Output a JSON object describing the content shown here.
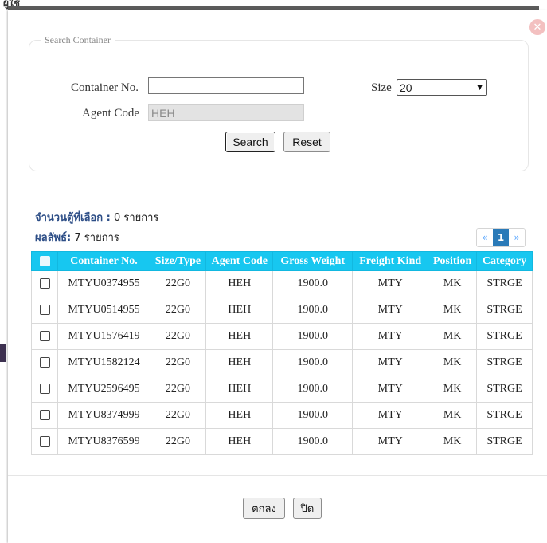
{
  "background": {
    "top_text": "ผู้ใช้"
  },
  "modal": {
    "close_icon": "close-circle-icon",
    "search_panel": {
      "legend": "Search Container",
      "container_no_label": "Container No.",
      "container_no_value": "",
      "size_label": "Size",
      "size_value": "20",
      "agent_code_label": "Agent Code",
      "agent_code_value": "HEH",
      "search_button": "Search",
      "reset_button": "Reset"
    },
    "selected_count_label": "จำนวนตู้ที่เลือก :",
    "selected_count_value": "0 รายการ",
    "results_label": "ผลลัพธ์:",
    "results_value": "7 รายการ",
    "pagination": {
      "prev": "«",
      "current": "1",
      "next": "»"
    },
    "table": {
      "headers": [
        "Container No.",
        "Size/Type",
        "Agent Code",
        "Gross Weight",
        "Freight Kind",
        "Position",
        "Category"
      ],
      "rows": [
        [
          "MTYU0374955",
          "22G0",
          "HEH",
          "1900.0",
          "MTY",
          "MK",
          "STRGE"
        ],
        [
          "MTYU0514955",
          "22G0",
          "HEH",
          "1900.0",
          "MTY",
          "MK",
          "STRGE"
        ],
        [
          "MTYU1576419",
          "22G0",
          "HEH",
          "1900.0",
          "MTY",
          "MK",
          "STRGE"
        ],
        [
          "MTYU1582124",
          "22G0",
          "HEH",
          "1900.0",
          "MTY",
          "MK",
          "STRGE"
        ],
        [
          "MTYU2596495",
          "22G0",
          "HEH",
          "1900.0",
          "MTY",
          "MK",
          "STRGE"
        ],
        [
          "MTYU8374999",
          "22G0",
          "HEH",
          "1900.0",
          "MTY",
          "MK",
          "STRGE"
        ],
        [
          "MTYU8376599",
          "22G0",
          "HEH",
          "1900.0",
          "MTY",
          "MK",
          "STRGE"
        ]
      ]
    },
    "ok_button": "ตกลง",
    "close_button": "ปิด"
  },
  "colors": {
    "table_header": "#17c7f0",
    "info_label": "#2c4d86",
    "pager_active": "#2a7ab8"
  }
}
